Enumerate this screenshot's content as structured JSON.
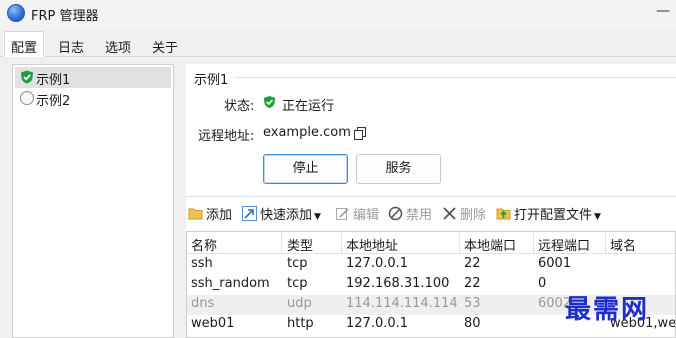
{
  "window": {
    "title": "FRP 管理器",
    "min_glyph": "—"
  },
  "tabs": [
    {
      "label": "配置",
      "active": true
    },
    {
      "label": "日志"
    },
    {
      "label": "选项"
    },
    {
      "label": "关于"
    }
  ],
  "instances": [
    {
      "name": "示例1",
      "status": "running",
      "selected": true
    },
    {
      "name": "示例2",
      "status": "stopped",
      "selected": false
    }
  ],
  "detail": {
    "group_title": "示例1",
    "status_label": "状态:",
    "status_value": "正在运行",
    "remote_label": "远程地址:",
    "remote_value": "example.com",
    "stop_button": "停止",
    "service_button": "服务"
  },
  "toolbar": {
    "add": "添加",
    "quick_add": "快速添加",
    "edit": "编辑",
    "disable": "禁用",
    "delete": "删除",
    "open_config": "打开配置文件"
  },
  "table": {
    "columns": [
      "名称",
      "类型",
      "本地地址",
      "本地端口",
      "远程端口",
      "域名"
    ],
    "rows": [
      {
        "name": "ssh",
        "type": "tcp",
        "local_addr": "127.0.0.1",
        "local_port": "22",
        "remote_port": "6001",
        "domain": "",
        "disabled": false
      },
      {
        "name": "ssh_random",
        "type": "tcp",
        "local_addr": "192.168.31.100",
        "local_port": "22",
        "remote_port": "0",
        "domain": "",
        "disabled": false
      },
      {
        "name": "dns",
        "type": "udp",
        "local_addr": "114.114.114.114",
        "local_port": "53",
        "remote_port": "6002",
        "domain": "",
        "disabled": true
      },
      {
        "name": "web01",
        "type": "http",
        "local_addr": "127.0.0.1",
        "local_port": "80",
        "remote_port": "",
        "domain": "web01,we...",
        "disabled": false
      }
    ]
  },
  "watermark": "最需网",
  "colors": {
    "running": "#1f9d3a",
    "watermark": "#1d2ec9",
    "accent": "#4a8bd6"
  }
}
